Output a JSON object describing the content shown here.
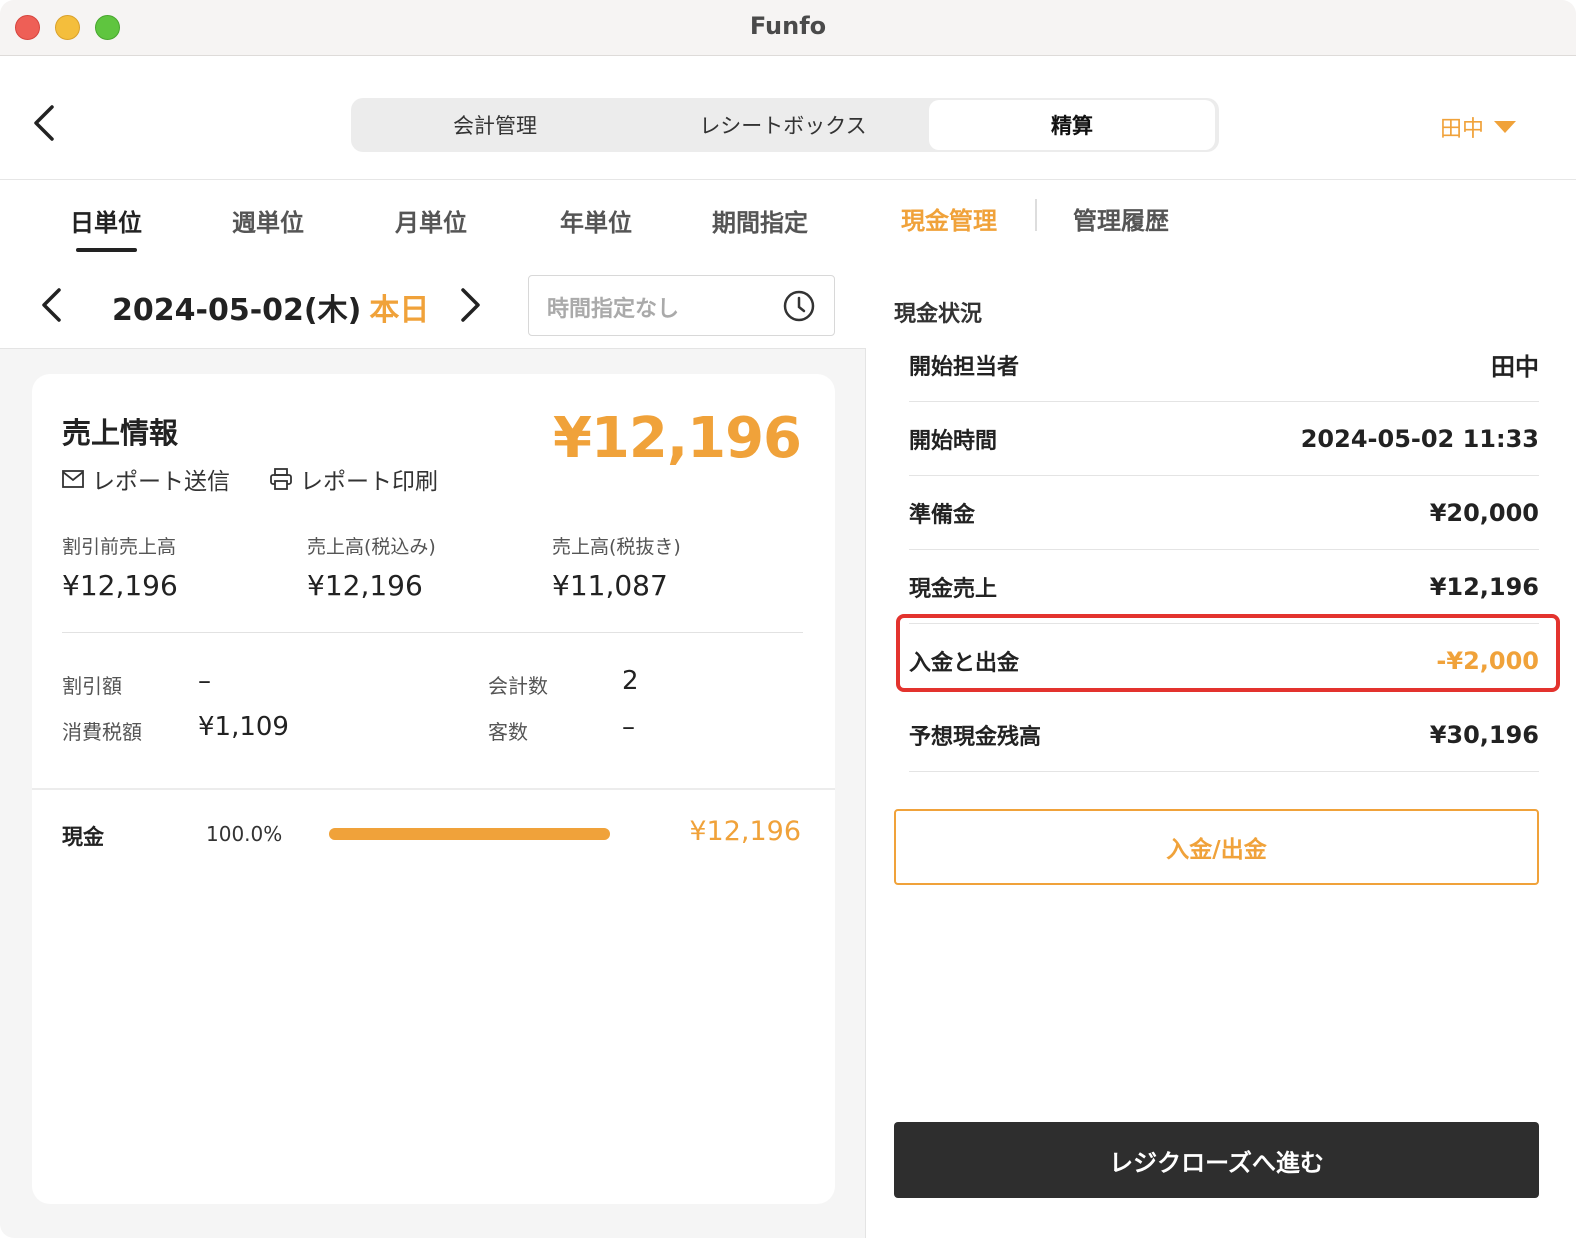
{
  "window": {
    "title": "Funfo"
  },
  "nav": {
    "tabs": [
      "会計管理",
      "レシートボックス",
      "精算"
    ],
    "active_tab": "精算",
    "user": "田中"
  },
  "period": {
    "tabs": [
      "日単位",
      "週単位",
      "月単位",
      "年単位",
      "期間指定"
    ],
    "active": "日単位",
    "date": "2024-05-02(木)",
    "today_label": "本日",
    "time_placeholder": "時間指定なし"
  },
  "sales": {
    "title": "売上情報",
    "total": "¥12,196",
    "send_report": "レポート送信",
    "print_report": "レポート印刷",
    "stats": [
      {
        "label": "割引前売上高",
        "value": "¥12,196"
      },
      {
        "label": "売上高(税込み)",
        "value": "¥12,196"
      },
      {
        "label": "売上高(税抜き)",
        "value": "¥11,087"
      }
    ],
    "discount_label": "割引額",
    "discount_value": "–",
    "tax_label": "消費税額",
    "tax_value": "¥1,109",
    "count_label": "会計数",
    "count_value": "2",
    "customers_label": "客数",
    "customers_value": "–",
    "payment": {
      "label": "現金",
      "percent": "100.0%",
      "fraction": 1.0,
      "amount": "¥12,196"
    }
  },
  "cash": {
    "tabs": [
      "現金管理",
      "管理履歴"
    ],
    "active_tab": "現金管理",
    "section_title": "現金状況",
    "rows": [
      {
        "label": "開始担当者",
        "value": "田中"
      },
      {
        "label": "開始時間",
        "value": "2024-05-02 11:33"
      },
      {
        "label": "準備金",
        "value": "¥20,000"
      },
      {
        "label": "現金売上",
        "value": "¥12,196"
      },
      {
        "label": "入金と出金",
        "value": "-¥2,000"
      },
      {
        "label": "予想現金残高",
        "value": "¥30,196"
      }
    ],
    "in_out_button": "入金/出金",
    "close_button": "レジクローズへ進む"
  },
  "colors": {
    "accent": "#f0a23a",
    "highlight": "#e3332e",
    "dark": "#2e2e2e"
  }
}
